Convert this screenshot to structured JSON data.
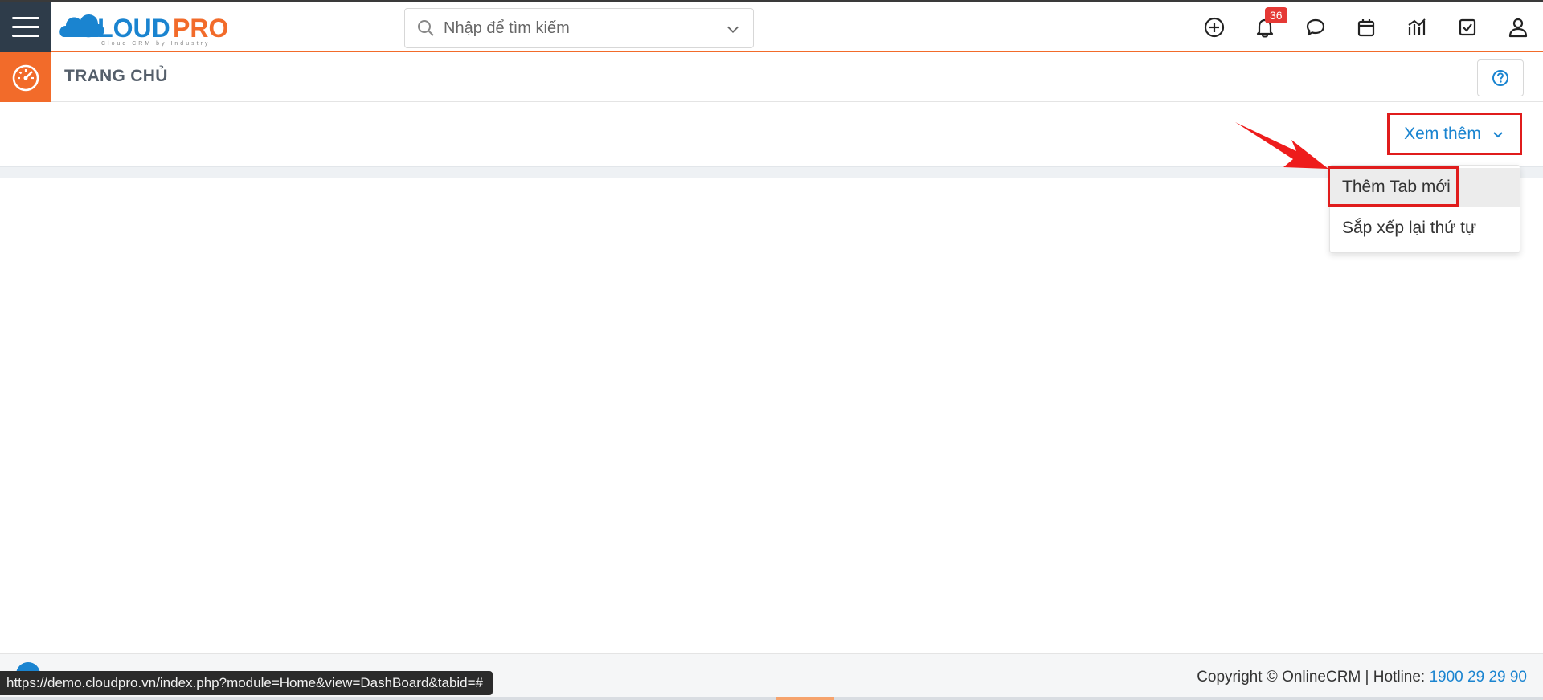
{
  "header": {
    "logo_text": "CLOUDPRO",
    "logo_tagline": "Cloud CRM by Industry",
    "search": {
      "placeholder": "Nhập để tìm kiếm"
    },
    "notifications_count": "36",
    "icons": [
      "add-icon",
      "bell-icon",
      "chat-icon",
      "calendar-icon",
      "report-icon",
      "task-icon",
      "user-icon"
    ]
  },
  "module": {
    "title": "TRANG CHỦ",
    "help_icon": "help-icon"
  },
  "tabs": {
    "more_label": "Xem thêm",
    "dropdown": [
      {
        "label": "Thêm Tab mới"
      },
      {
        "label": "Sắp xếp lại thứ tự"
      }
    ]
  },
  "footer": {
    "copyright": "Copyright © OnlineCRM",
    "hotline_label": "Hotline:",
    "hotline": "1900 29 29 90"
  },
  "status_url": "https://demo.cloudpro.vn/index.php?module=Home&view=DashBoard&tabid=#",
  "colors": {
    "brand_orange": "#f26b2a",
    "brand_blue": "#1a84d0",
    "sidebar_dark": "#2e3c4a",
    "highlight_red": "#e01c1c"
  }
}
